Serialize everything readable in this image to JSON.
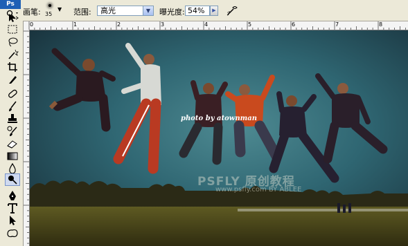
{
  "app": {
    "logo": "Ps"
  },
  "options_bar": {
    "brush_label": "画笔:",
    "brush_size": "35",
    "range_label": "范围:",
    "range_value": "高光",
    "exposure_label": "曝光度:",
    "exposure_value": "54%"
  },
  "ruler": {
    "top_labels": [
      "0",
      "1",
      "2",
      "3",
      "4",
      "5",
      "6",
      "7",
      "8"
    ]
  },
  "canvas": {
    "photo_credit": "photo by atownman",
    "watermark": "PSFLY 原创教程",
    "watermark_url": "www.psfly.com BY ABLEE"
  },
  "colors": {
    "sky_top": "#1f3f4c",
    "sky_mid": "#2f6672",
    "ground": "#4b4a1c",
    "red_shirt": "#c94a1e"
  },
  "tools": [
    "move-tool",
    "marquee-tool",
    "lasso-tool",
    "magic-wand-tool",
    "crop-tool",
    "slice-tool",
    "healing-brush-tool",
    "brush-tool",
    "clone-stamp-tool",
    "history-brush-tool",
    "eraser-tool",
    "gradient-tool",
    "blur-tool",
    "dodge-tool",
    "pen-tool",
    "type-tool",
    "path-selection-tool",
    "custom-shape-tool"
  ]
}
